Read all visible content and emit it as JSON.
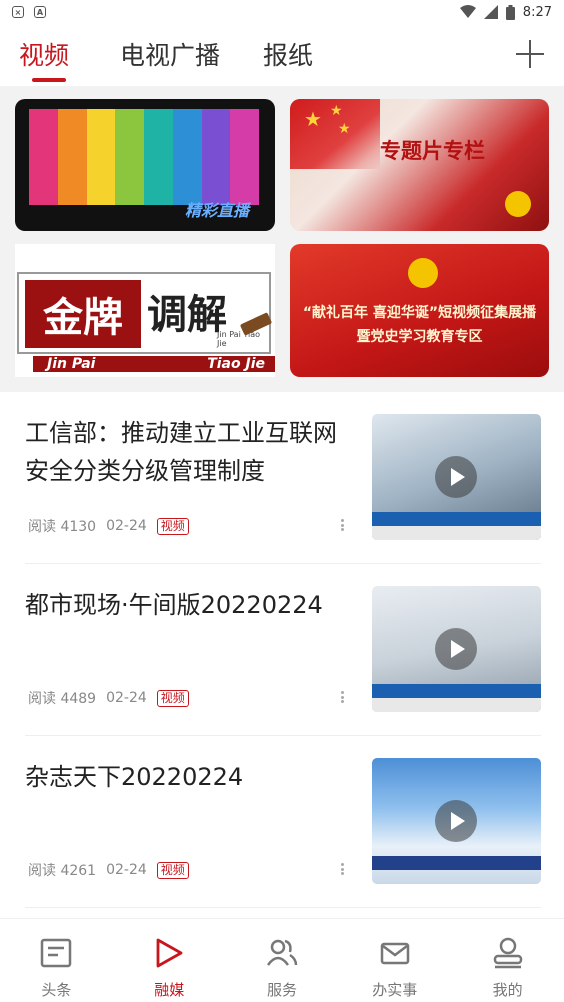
{
  "status_bar": {
    "time": "8:27",
    "left_icons": [
      "close-icon",
      "a-icon"
    ],
    "right_icons": [
      "wifi-icon",
      "signal-icon",
      "battery-icon"
    ]
  },
  "top_tabs": {
    "tabs": [
      {
        "label": "视频",
        "active": true
      },
      {
        "label": "电视广播",
        "active": false
      },
      {
        "label": "报纸",
        "active": false
      }
    ],
    "add_icon": "plus-icon",
    "accent_color": "#c8161d"
  },
  "banners": [
    {
      "caption": "精彩直播"
    },
    {
      "caption": "专题片专栏"
    },
    {
      "caption_cn_1": "金牌",
      "caption_cn_2": "调解",
      "caption_pinyin_small": "Jin Pai Tiao Jie",
      "caption_pinyin_left": "Jin Pai",
      "caption_pinyin_right": "Tiao Jie"
    },
    {
      "line1": "“献礼百年 喜迎华诞”短视频征集展播",
      "line2": "暨党史学习教育专区"
    }
  ],
  "news": [
    {
      "title": "工信部：推动建立工业互联网安全分类分级管理制度",
      "reads": "阅读 4130",
      "date": "02-24",
      "badge": "视频"
    },
    {
      "title": "都市现场·午间版20220224",
      "reads": "阅读 4489",
      "date": "02-24",
      "badge": "视频"
    },
    {
      "title": "杂志天下20220224",
      "reads": "阅读 4261",
      "date": "02-24",
      "badge": "视频"
    }
  ],
  "bottom_nav": [
    {
      "label": "头条",
      "icon": "news-icon",
      "active": false
    },
    {
      "label": "融媒",
      "icon": "play-icon",
      "active": true
    },
    {
      "label": "服务",
      "icon": "users-icon",
      "active": false
    },
    {
      "label": "办实事",
      "icon": "mail-icon",
      "active": false
    },
    {
      "label": "我的",
      "icon": "profile-icon",
      "active": false
    }
  ]
}
